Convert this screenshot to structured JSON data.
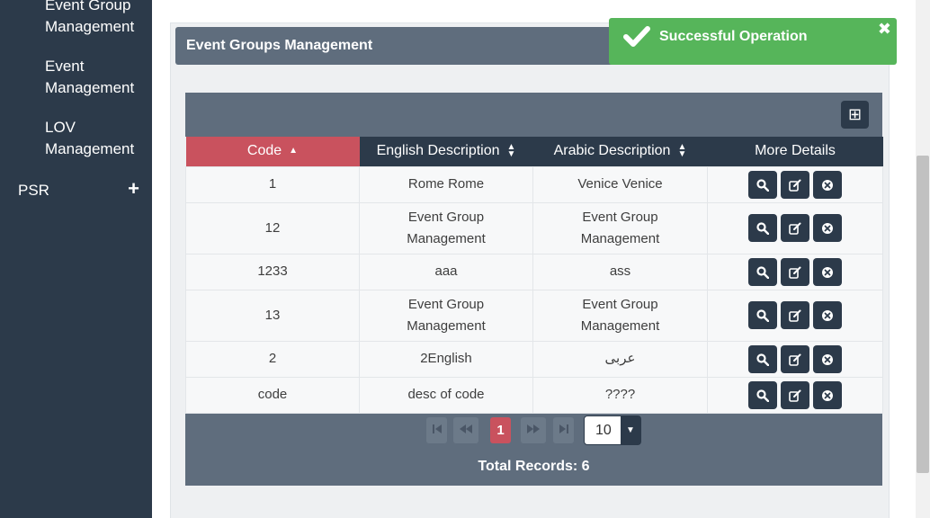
{
  "sidebar": {
    "items": [
      {
        "line1": "Event Group",
        "line2": "Management"
      },
      {
        "line1": "Event",
        "line2": "Management"
      },
      {
        "line1": "LOV",
        "line2": "Management"
      }
    ],
    "psr": {
      "label": "PSR",
      "icon": "+"
    }
  },
  "panel": {
    "title": "Event Groups Management"
  },
  "toolbar": {
    "add_icon": "⊞"
  },
  "table": {
    "headers": {
      "code": "Code",
      "english": "English Description",
      "arabic": "Arabic Description",
      "details": "More Details"
    },
    "rows": [
      {
        "code": "1",
        "en": "Rome Rome",
        "ar": "Venice Venice"
      },
      {
        "code": "12",
        "en": "Event Group Management",
        "ar": "Event Group Management"
      },
      {
        "code": "1233",
        "en": "aaa",
        "ar": "ass"
      },
      {
        "code": "13",
        "en": "Event Group Management",
        "ar": "Event Group Management"
      },
      {
        "code": "2",
        "en": "2English",
        "ar": "عربى"
      },
      {
        "code": "code",
        "en": "desc of code",
        "ar": "????"
      }
    ]
  },
  "pager": {
    "current": "1",
    "rows_per_page": "10",
    "total": "Total Records: 6"
  },
  "toast": {
    "message": "Successful Operation",
    "close": "✖"
  },
  "colors": {
    "sidebar": "#2c3a4a",
    "header_active": "#c9525e",
    "toast": "#56b55a",
    "panel_header": "#5f6d7d"
  }
}
